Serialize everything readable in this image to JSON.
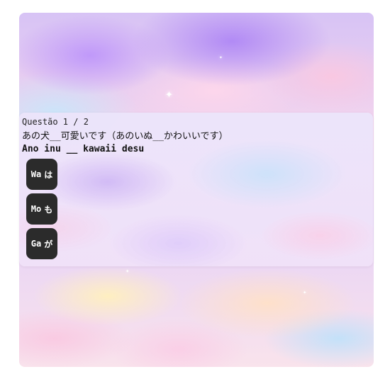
{
  "quiz": {
    "counter": "Questão 1 / 2",
    "japanese": "あの犬__可愛いです（あのいぬ__かわいいです）",
    "romaji": "Ano inu __ kawaii desu",
    "options": [
      {
        "romaji": "Wa",
        "kana": "は"
      },
      {
        "romaji": "Mo",
        "kana": "も"
      },
      {
        "romaji": "Ga",
        "kana": "が"
      }
    ]
  }
}
